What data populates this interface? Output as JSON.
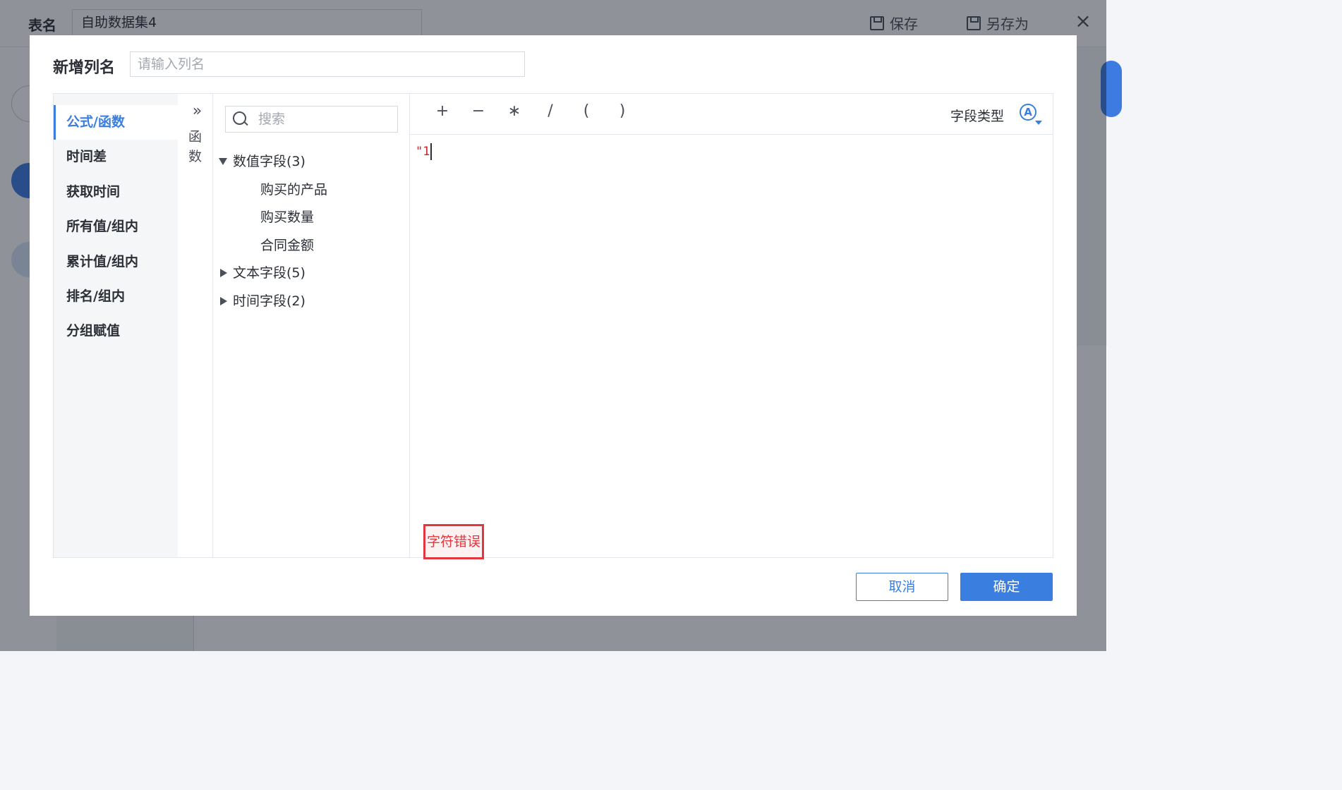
{
  "header": {
    "table_name_label": "表名",
    "table_name_value": "自助数据集4",
    "save_label": "保存",
    "save_as_label": "另存为",
    "close_icon": "close-icon"
  },
  "dialog": {
    "title": "新增列名",
    "name_placeholder": "请输入列名",
    "categories": [
      {
        "label": "公式/函数",
        "active": true
      },
      {
        "label": "时间差"
      },
      {
        "label": "获取时间"
      },
      {
        "label": "所有值/组内"
      },
      {
        "label": "累计值/组内"
      },
      {
        "label": "排名/组内"
      },
      {
        "label": "分组赋值"
      }
    ],
    "function_toggle": {
      "chevron": "»",
      "label_line1": "函",
      "label_line2": "数"
    },
    "search": {
      "placeholder": "搜索"
    },
    "field_groups": [
      {
        "label": "数值字段(3)",
        "expanded": true,
        "items": [
          "购买的产品",
          "购买数量",
          "合同金额"
        ]
      },
      {
        "label": "文本字段(5)",
        "expanded": false
      },
      {
        "label": "时间字段(2)",
        "expanded": false
      }
    ],
    "operators": [
      "+",
      "−",
      "∗",
      "/",
      "(",
      ")"
    ],
    "field_type_label": "字段类型",
    "field_type_icon": "Ⓐ",
    "formula_text": "\"1",
    "error_message": "字符错误",
    "cancel_label": "取消",
    "ok_label": "确定"
  },
  "colors": {
    "accent": "#3a7fe0",
    "error": "#e0383e"
  }
}
